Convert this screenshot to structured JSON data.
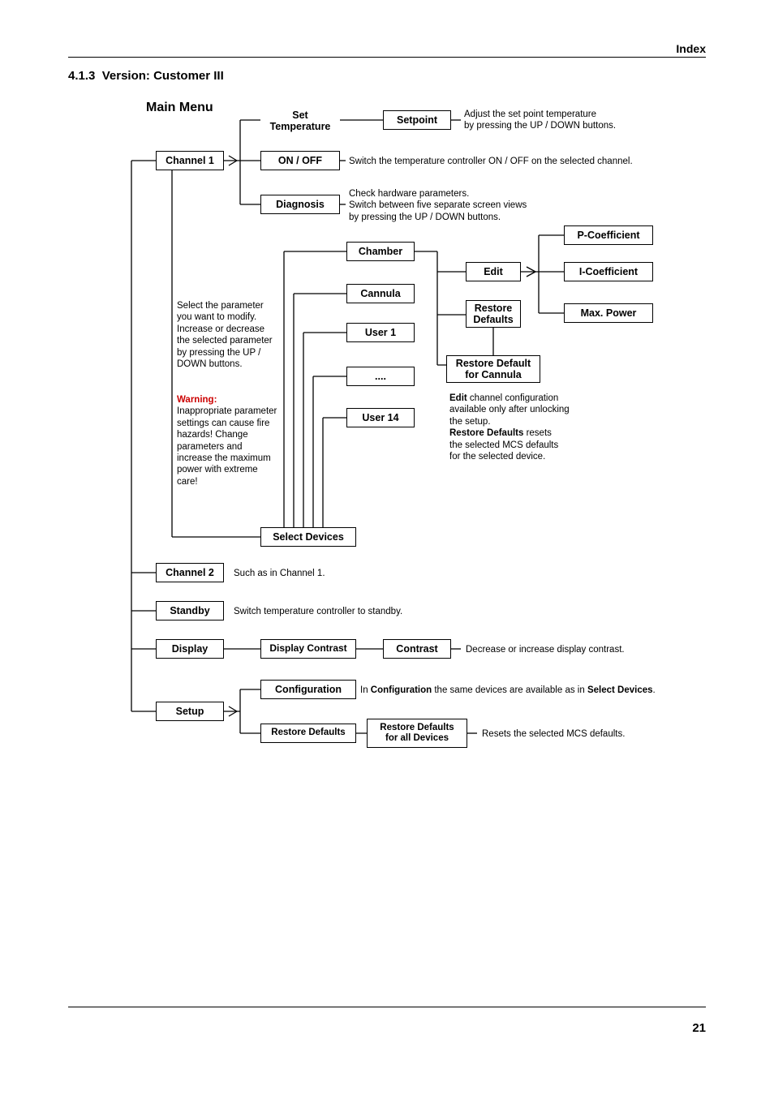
{
  "header": {
    "right": "Index"
  },
  "section": {
    "number": "4.1.3",
    "title": "Version: Customer III"
  },
  "page_number": "21",
  "labels": {
    "main_menu": "Main Menu",
    "channel1": "Channel 1",
    "set_temp_l1": "Set",
    "set_temp_l2": "Temperature",
    "onoff": "ON / OFF",
    "diagnosis": "Diagnosis",
    "setpoint": "Setpoint",
    "select_devices": "Select Devices",
    "chamber": "Chamber",
    "cannula": "Cannula",
    "user1": "User 1",
    "ellipsis": "....",
    "user14": "User 14",
    "edit": "Edit",
    "restore_defaults_l1": "Restore",
    "restore_defaults_l2": "Defaults",
    "restore_cannula_l1": "Restore Default",
    "restore_cannula_l2": "for Cannula",
    "pcoef": "P-Coefficient",
    "icoef": "I-Coefficient",
    "maxpower": "Max. Power",
    "channel2": "Channel 2",
    "standby": "Standby",
    "display": "Display",
    "setup": "Setup",
    "display_contrast": "Display Contrast",
    "contrast": "Contrast",
    "configuration": "Configuration",
    "restore_defaults_btn": "Restore Defaults",
    "restore_all_l1": "Restore Defaults",
    "restore_all_l2": "for all Devices"
  },
  "texts": {
    "setpoint_note": "Adjust the set point temperature\nby pressing the UP / DOWN buttons.",
    "onoff_note": "Switch the temperature controller ON / OFF on the selected channel.",
    "diag_note": "Check hardware parameters.\nSwitch between five separate screen views\nby pressing the UP / DOWN buttons.",
    "select_note_1": "Select the parameter you want to modify. Increase or decrease the selected parameter by pressing the UP / DOWN buttons.",
    "warning_label": "Warning:",
    "warning_body": "Inappropriate parameter settings can cause fire hazards! Change parameters and increase the maximum power with extreme care!",
    "edit_note_l1a": "Edit",
    "edit_note_l1b": " channel configuration",
    "edit_note_l2": "available only after unlocking",
    "edit_note_l3": "the setup.",
    "edit_note_l4a": "Restore Defaults",
    "edit_note_l4b": " resets",
    "edit_note_l5": "the selected MCS defaults",
    "edit_note_l6": "for the selected device.",
    "ch2_note": "Such as in Channel 1.",
    "standby_note": "Switch temperature controller to standby.",
    "contrast_note": "Decrease or increase display contrast.",
    "config_note_a": "In ",
    "config_note_b": "Configuration",
    "config_note_c": " the same devices are available as in ",
    "config_note_d": "Select Devices",
    "config_note_e": ".",
    "restore_all_note": "Resets the selected MCS defaults."
  }
}
